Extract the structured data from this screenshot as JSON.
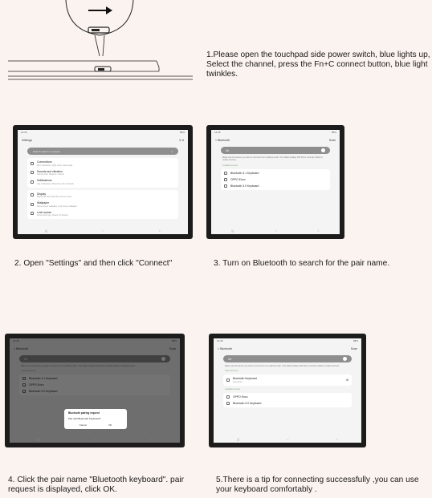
{
  "step1": {
    "text": "1.Please open the touchpad side power switch, blue lights up, Select the channel, press the Fn+C connect button, blue light twinkles."
  },
  "step2": {
    "text": "2. Open \"Settings\" and then click \"Connect\""
  },
  "step3": {
    "text": "3. Turn on Bluetooth to search for the pair name."
  },
  "step4": {
    "text": "4. Click the pair name \"Bluetooth keyboard\". pair request is displayed, click OK."
  },
  "step5": {
    "text": "5.There is a tip for connecting successfully ,you can use your keyboard comfortably ."
  },
  "settings_screen": {
    "title": "Settings",
    "search_placeholder": "Search options or people",
    "items": [
      {
        "label": "Connections",
        "sub": "Wi-Fi, Bluetooth, Flight mode, Data usage"
      },
      {
        "label": "Sounds and vibration",
        "sub": "Sound mode, Ringtone, Volume"
      },
      {
        "label": "Notifications",
        "sub": "App notifications, Status bar, Do not disturb"
      },
      {
        "label": "Display",
        "sub": "Brightness, Blue light filter, Screen mode"
      },
      {
        "label": "Wallpaper",
        "sub": "Home screen wallpaper, Lock screen wallpaper"
      },
      {
        "label": "Lock screen",
        "sub": "Screen lock type, Always On Display"
      }
    ]
  },
  "bluetooth_screen": {
    "back_label": "< Bluetooth",
    "scan_label": "Scan",
    "toggle_label": "On",
    "note": "Make sure the device you want to connect to is in pairing mode. Your tablet (Galaxy Tab S6) is currently visible to nearby devices.",
    "section_available": "Available devices",
    "devices": [
      "Bluetooth 3.1 Keyboard",
      "OPPO Enco",
      "Bluetooth 3.0 Keyboard"
    ]
  },
  "pair_dialog": {
    "title": "Bluetooth pairing request",
    "text": "Pair with Bluetooth Keyboard?",
    "cancel": "Cancel",
    "ok": "OK"
  },
  "connected_screen": {
    "section_paired": "Paired devices",
    "paired_device": "Bluetooth Keyboard",
    "paired_status": "Connected",
    "section_available": "Available devices",
    "devices": [
      "OPPO Enco",
      "Bluetooth 3.0 Keyboard"
    ]
  }
}
